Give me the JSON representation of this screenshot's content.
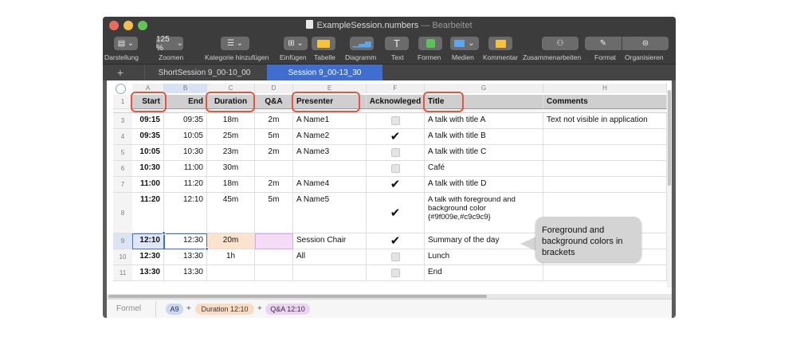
{
  "window": {
    "title": "ExampleSession.numbers",
    "status": "— Bearbeitet",
    "accent": "#3d6ed0"
  },
  "toolbar": {
    "darstellung": "Darstellung",
    "zoom_value": "125 %",
    "zoomen": "Zoomen",
    "kategorie": "Kategorie hinzufügen",
    "einfuegen": "Einfügen",
    "tabelle": "Tabelle",
    "diagramm": "Diagramm",
    "text": "Text",
    "formen": "Formen",
    "medien": "Medien",
    "kommentar": "Kommentar",
    "zusammenarbeiten": "Zusammenarbeiten",
    "format": "Format",
    "organisieren": "Organisieren"
  },
  "tabs": {
    "add": "+",
    "items": [
      {
        "label": "ShortSession 9_00-10_00",
        "active": false
      },
      {
        "label": "Session 9_00-13_30",
        "active": true
      }
    ]
  },
  "columns": [
    "A",
    "B",
    "C",
    "D",
    "E",
    "F",
    "G",
    "H"
  ],
  "header_row": {
    "num": "1",
    "cells": [
      "Start",
      "End",
      "Duration",
      "Q&A",
      "Presenter",
      "Acknowleged",
      "Title",
      "Comments"
    ]
  },
  "rows": [
    {
      "num": "3",
      "start": "09:15",
      "end": "09:35",
      "duration": "18m",
      "qa": "2m",
      "presenter": "A Name1",
      "ack": false,
      "title": "A talk with title A",
      "comment": "Text not visible in application"
    },
    {
      "num": "4",
      "start": "09:35",
      "end": "10:05",
      "duration": "25m",
      "qa": "5m",
      "presenter": "A Name2",
      "ack": true,
      "title": "A talk with title B",
      "comment": ""
    },
    {
      "num": "5",
      "start": "10:05",
      "end": "10:30",
      "duration": "23m",
      "qa": "2m",
      "presenter": "A Name3",
      "ack": false,
      "title": "A talk with title C",
      "comment": ""
    },
    {
      "num": "6",
      "start": "10:30",
      "end": "11:00",
      "duration": "30m",
      "qa": "",
      "presenter": "",
      "ack": false,
      "title": "Café",
      "comment": ""
    },
    {
      "num": "7",
      "start": "11:00",
      "end": "11:20",
      "duration": "18m",
      "qa": "2m",
      "presenter": "A Name4",
      "ack": true,
      "title": "A talk with title D",
      "comment": ""
    },
    {
      "num": "8",
      "start": "11:20",
      "end": "12:10",
      "duration": "45m",
      "qa": "5m",
      "presenter": "A Name5",
      "ack": true,
      "title": "A talk with foreground and",
      "title2": "background color",
      "title3": "{#9f009e,#c9c9c9}",
      "comment": ""
    },
    {
      "num": "9",
      "start": "12:10",
      "end": "12:30",
      "duration": "20m",
      "qa": "",
      "presenter": "Session Chair",
      "ack": true,
      "title": "Summary of the day",
      "comment": ""
    },
    {
      "num": "10",
      "start": "12:30",
      "end": "13:30",
      "duration": "1h",
      "qa": "",
      "presenter": "All",
      "ack": false,
      "title": "Lunch",
      "comment": ""
    },
    {
      "num": "11",
      "start": "13:30",
      "end": "13:30",
      "duration": "",
      "qa": "",
      "presenter": "",
      "ack": false,
      "title": "End",
      "comment": ""
    }
  ],
  "callout": {
    "line1": "Foreground and",
    "line2": "background colors in",
    "line3": "brackets"
  },
  "formula": {
    "label": "Formel",
    "tokens": [
      "A9",
      "Duration 12:10",
      "Q&A 12:10"
    ],
    "plus": "+"
  },
  "colors": {
    "highlight_red": "#e8553f",
    "selected_blue": "#3d6ed0",
    "duration_fill": "#fbe3cd",
    "qa_fill": "#f4dcf7"
  }
}
